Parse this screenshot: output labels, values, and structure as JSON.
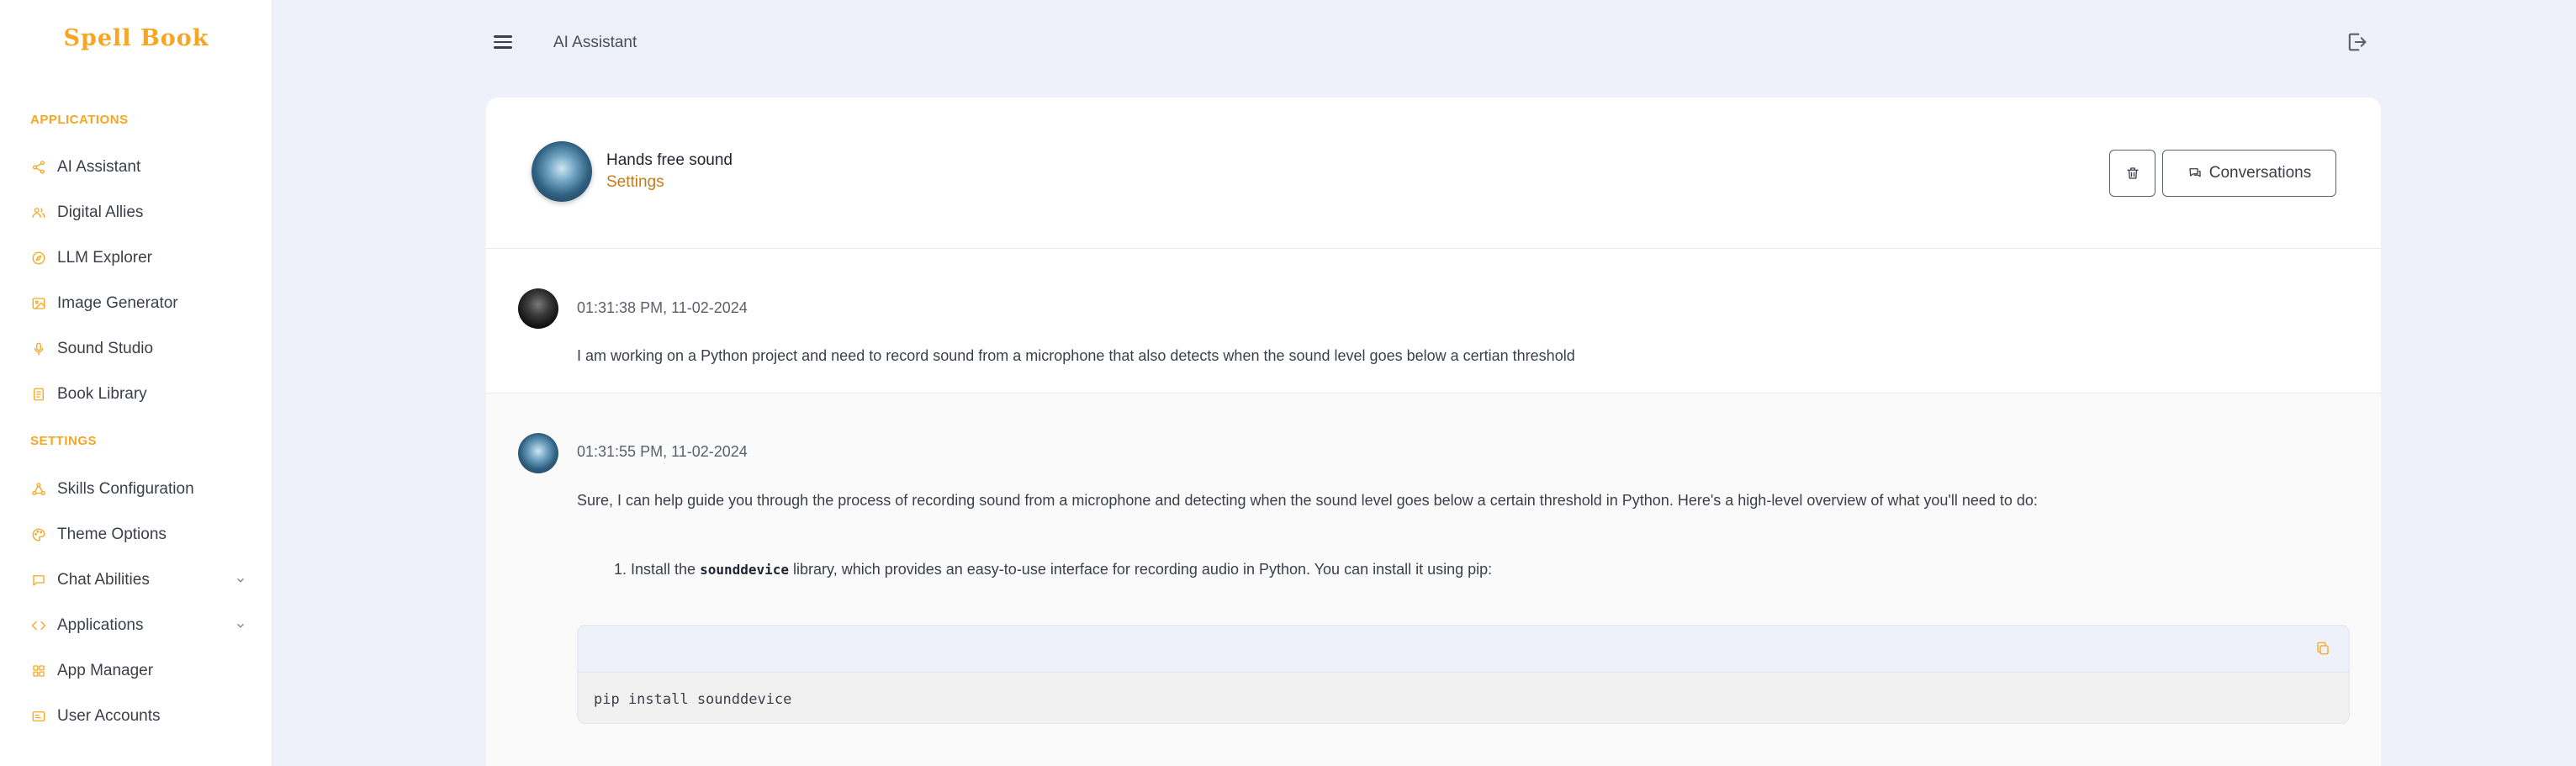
{
  "brand": "Spell Book",
  "sidebar": {
    "applications_label": "APPLICATIONS",
    "settings_label": "SETTINGS",
    "applications": [
      {
        "label": "AI Assistant",
        "icon": "share-nodes-icon"
      },
      {
        "label": "Digital Allies",
        "icon": "users-icon"
      },
      {
        "label": "LLM Explorer",
        "icon": "compass-icon"
      },
      {
        "label": "Image Generator",
        "icon": "image-icon"
      },
      {
        "label": "Sound Studio",
        "icon": "microphone-icon"
      },
      {
        "label": "Book Library",
        "icon": "book-icon"
      }
    ],
    "settings": [
      {
        "label": "Skills Configuration",
        "icon": "network-icon"
      },
      {
        "label": "Theme Options",
        "icon": "palette-icon"
      },
      {
        "label": "Chat Abilities",
        "icon": "chat-icon",
        "expandable": true
      },
      {
        "label": "Applications",
        "icon": "code-icon",
        "expandable": true
      },
      {
        "label": "App Manager",
        "icon": "grid-icon"
      },
      {
        "label": "User Accounts",
        "icon": "id-card-icon"
      }
    ]
  },
  "topbar": {
    "title": "AI Assistant"
  },
  "assistant": {
    "name": "Hands free sound",
    "settings_link": "Settings",
    "conversations_button": "Conversations"
  },
  "messages": {
    "user": {
      "timestamp": "01:31:38 PM, 11-02-2024",
      "text": "I am working on a Python project and need to record sound from a microphone that also detects when the sound level goes below a certian threshold"
    },
    "ai": {
      "timestamp": "01:31:55 PM, 11-02-2024",
      "intro": "Sure, I can help guide you through the process of recording sound from a microphone and detecting when the sound level goes below a certain threshold in Python. Here's a high-level overview of what you'll need to do:",
      "step1_prefix": "1. Install the ",
      "step1_code": "sounddevice",
      "step1_suffix": " library, which provides an easy-to-use interface for recording audio in Python. You can install it using pip:",
      "code": "pip install sounddevice"
    }
  },
  "colors": {
    "accent": "#f5a623",
    "settings_link": "#c77a1a",
    "background": "#eef1f9"
  }
}
